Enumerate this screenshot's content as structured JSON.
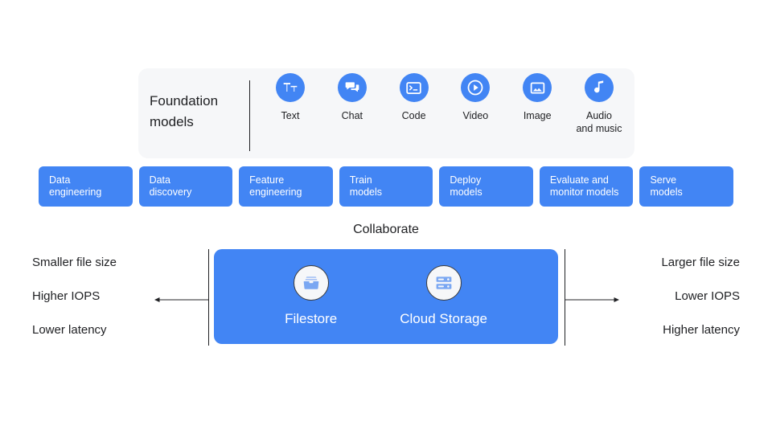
{
  "foundation": {
    "title_line1": "Foundation",
    "title_line2": "models",
    "modalities": [
      {
        "label_line1": "Text",
        "label_line2": "",
        "icon": "text-icon"
      },
      {
        "label_line1": "Chat",
        "label_line2": "",
        "icon": "chat-bubble-icon"
      },
      {
        "label_line1": "Code",
        "label_line2": "",
        "icon": "code-terminal-icon"
      },
      {
        "label_line1": "Video",
        "label_line2": "",
        "icon": "play-circle-icon"
      },
      {
        "label_line1": "Image",
        "label_line2": "",
        "icon": "image-icon"
      },
      {
        "label_line1": "Audio",
        "label_line2": "and music",
        "icon": "music-note-icon"
      }
    ]
  },
  "pipeline": {
    "steps": [
      {
        "line1": "Data",
        "line2": "engineering"
      },
      {
        "line1": "Data",
        "line2": "discovery"
      },
      {
        "line1": "Feature",
        "line2": "engineering"
      },
      {
        "line1": "Train",
        "line2": "models"
      },
      {
        "line1": "Deploy",
        "line2": "models"
      },
      {
        "line1": "Evaluate and",
        "line2": "monitor models"
      },
      {
        "line1": "Serve",
        "line2": "models"
      }
    ]
  },
  "storage": {
    "collaborate_label": "Collaborate",
    "items": [
      {
        "label": "Filestore",
        "icon": "file-tray-icon"
      },
      {
        "label": "Cloud Storage",
        "icon": "server-rack-icon"
      }
    ],
    "left_axis": {
      "line1": "Smaller file size",
      "line2": "Higher IOPS",
      "line3": "Lower latency"
    },
    "right_axis": {
      "line1": "Larger file size",
      "line2": "Lower IOPS",
      "line3": "Higher latency"
    }
  },
  "colors": {
    "accent_blue": "#4285f4",
    "card_background": "#f6f7f9",
    "text": "#202124",
    "page_background": "#ffffff"
  }
}
